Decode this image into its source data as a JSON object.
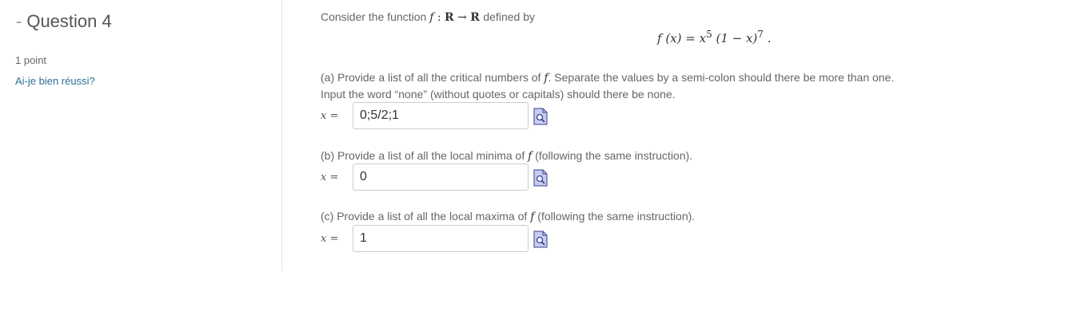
{
  "question": {
    "dash": "-",
    "title": "Question 4",
    "points": "1 point",
    "check_link": "Ai-je bien réussi?"
  },
  "problem": {
    "intro_before": "Consider the function",
    "function_name": "f",
    "colon": ":",
    "domain": "R",
    "arrow": "→",
    "codomain": "R",
    "intro_after": "defined by",
    "formula": {
      "lhs": "f (x) = x",
      "exp1": "5",
      "mid": " (1 − x)",
      "exp2": "7",
      "end": " ."
    }
  },
  "parts": [
    {
      "text_before": "(a) Provide a list of all the critical numbers of",
      "fn": "f",
      "text_after": ". Separate the values by a semi-colon should there be more than one.",
      "line2": "Input the word “none” (without quotes or capitals) should there be none.",
      "label": "x =",
      "value": "0;5/2;1"
    },
    {
      "text_before": "(b) Provide a list of all the local minima of",
      "fn": "f",
      "text_after": "(following the same instruction).",
      "label": "x =",
      "value": "0"
    },
    {
      "text_before": "(c) Provide a list of all the local maxima of",
      "fn": "f",
      "text_after": "(following the same instruction).",
      "label": "x =",
      "value": "1"
    }
  ],
  "icons": {
    "preview": "preview-document-icon"
  },
  "colors": {
    "link": "#2a6f96",
    "text": "#666666",
    "icon_fill": "#c8cdf0",
    "icon_stroke": "#3b3f8f"
  }
}
